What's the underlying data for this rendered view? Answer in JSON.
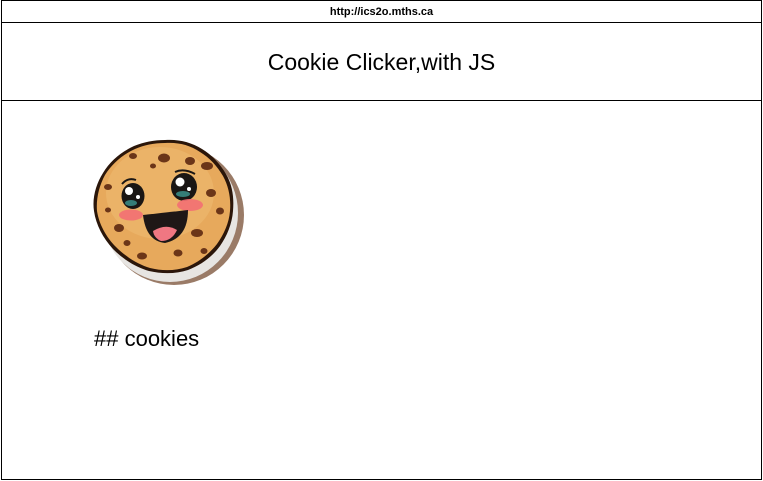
{
  "browser": {
    "url": "http://ics2o.mths.ca"
  },
  "header": {
    "title": "Cookie Clicker,with JS"
  },
  "main": {
    "cookie_image": "smiling-cookie-image",
    "cookie_count_text": "## cookies"
  }
}
